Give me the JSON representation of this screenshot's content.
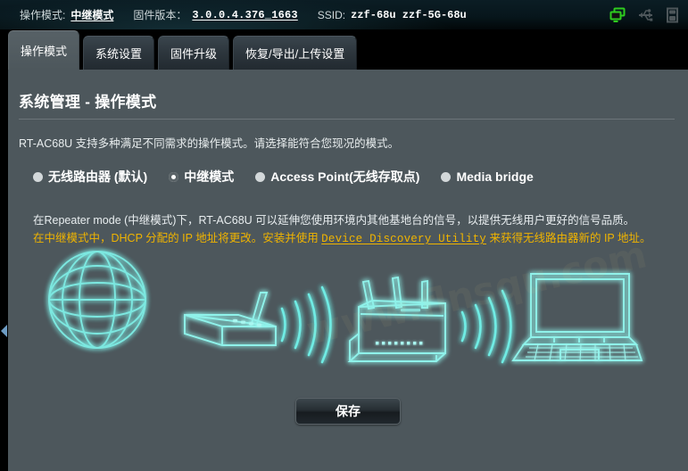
{
  "topbar": {
    "mode_label": "操作模式:",
    "mode_value": "中继模式",
    "firmware_label": "固件版本：",
    "firmware_value": "3.0.0.4.376_1663",
    "ssid_label": "SSID:",
    "ssid_value": "zzf-68u  zzf-5G-68u",
    "icons": [
      {
        "name": "network-client-icon",
        "color": "#2ecc1e"
      },
      {
        "name": "usb-icon",
        "color": "#4a5357"
      },
      {
        "name": "printer-icon",
        "color": "#4a5357"
      }
    ]
  },
  "tabs": [
    {
      "label": "操作模式",
      "active": true
    },
    {
      "label": "系统设置",
      "active": false
    },
    {
      "label": "固件升级",
      "active": false
    },
    {
      "label": "恢复/导出/上传设置",
      "active": false
    }
  ],
  "page": {
    "title": "系统管理 - 操作模式",
    "description": "RT-AC68U 支持多种满足不同需求的操作模式。请选择能符合您现况的模式。"
  },
  "operation_modes": [
    {
      "label": "无线路由器 (默认)",
      "selected": false
    },
    {
      "label": "中继模式",
      "selected": true
    },
    {
      "label": "Access Point(无线存取点)",
      "selected": false
    },
    {
      "label": "Media bridge",
      "selected": false
    }
  ],
  "notes": {
    "line1": "在Repeater mode (中继模式)下，RT-AC68U 可以延伸您使用环境内其他基地台的信号，以提供无线用户更好的信号品质。",
    "line2_before": "在中继模式中，DHCP 分配的 IP 地址将更改。安装并使用 ",
    "line2_link": "Device Discovery Utility",
    "line2_after": " 来获得无线路由器新的 IP 地址。"
  },
  "diagram": {
    "globe_name": "internet-globe",
    "modem_name": "gateway-modem",
    "router_name": "asus-repeater-router",
    "laptop_name": "client-laptop",
    "accent_color": "#5fe8e0",
    "watermark": "www.flnsqu.com"
  },
  "footer": {
    "save_label": "保存"
  },
  "colors": {
    "panel_bg": "#4d575c",
    "header_bg": "#07161c",
    "accent_cyan": "#5fe8e0",
    "warning_orange": "#f0b400",
    "status_green": "#2ecc1e"
  }
}
